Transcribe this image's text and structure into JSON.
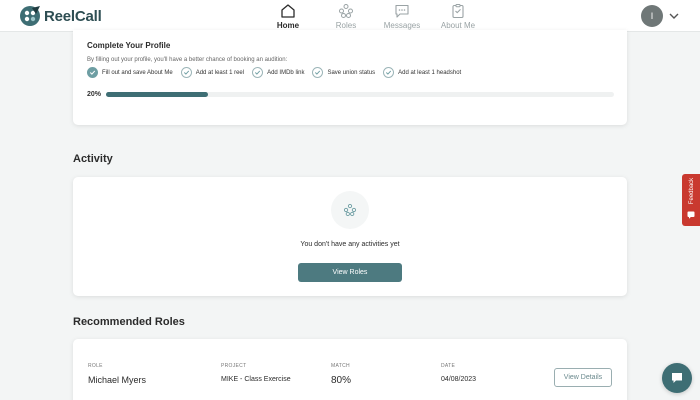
{
  "app": {
    "name": "ReelCall"
  },
  "nav": {
    "items": [
      {
        "label": "Home",
        "icon": "home-icon",
        "active": true
      },
      {
        "label": "Roles",
        "icon": "roles-icon",
        "active": false
      },
      {
        "label": "Messages",
        "icon": "messages-icon",
        "active": false
      },
      {
        "label": "About Me",
        "icon": "about-me-icon",
        "active": false
      }
    ]
  },
  "user": {
    "initial": "I"
  },
  "profile": {
    "title": "Complete Your Profile",
    "subtitle": "By filling out your profile, you'll have a better chance of booking an audition:",
    "tasks": [
      {
        "label": "Fill out and save About Me",
        "done": true
      },
      {
        "label": "Add at least 1 reel",
        "done": false
      },
      {
        "label": "Add IMDb link",
        "done": false
      },
      {
        "label": "Save union status",
        "done": false
      },
      {
        "label": "Add at least 1 headshot",
        "done": false
      }
    ],
    "progress_label": "20%",
    "progress_fraction": 0.2
  },
  "activity": {
    "title": "Activity",
    "empty_text": "You don't have any activities yet",
    "button_label": "View Roles"
  },
  "recommended": {
    "title": "Recommended Roles",
    "columns": {
      "role": "ROLE",
      "project": "PROJECT",
      "match": "MATCH",
      "date": "DATE"
    },
    "rows": [
      {
        "role": "Michael Myers",
        "project": "MIKE - Class Exercise",
        "match": "80%",
        "date": "04/08/2023",
        "action": "View Details"
      }
    ]
  },
  "feedback": {
    "label": "Feedback"
  },
  "colors": {
    "accent": "#3e6e74",
    "button": "#4d7a80",
    "feedback": "#c9392f"
  }
}
